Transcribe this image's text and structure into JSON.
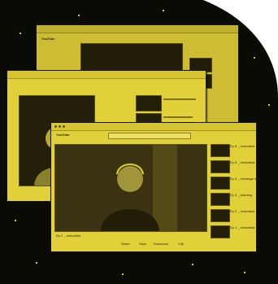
{
  "windows": {
    "main": {
      "logo": "YouTube",
      "video_title": "Ep 2 _ embodied",
      "actions": [
        "Share",
        "Save",
        "Download",
        "Clip"
      ],
      "sidebar": [
        {
          "title": "Ep 6 _ embodied"
        },
        {
          "title": "Ep 5 _ embodied"
        },
        {
          "title": "Ep 4 _ message with"
        },
        {
          "title": "Ep 3 _ learning"
        },
        {
          "title": "Ep 2 _ embodied"
        },
        {
          "title": "Ep 1 _ embodied"
        }
      ]
    },
    "back": {
      "logo": "YouTube"
    }
  },
  "colors": {
    "accent_yellow": "#e2d03a",
    "background_black": "#0b0b06",
    "window_bar": "#d6c434"
  }
}
